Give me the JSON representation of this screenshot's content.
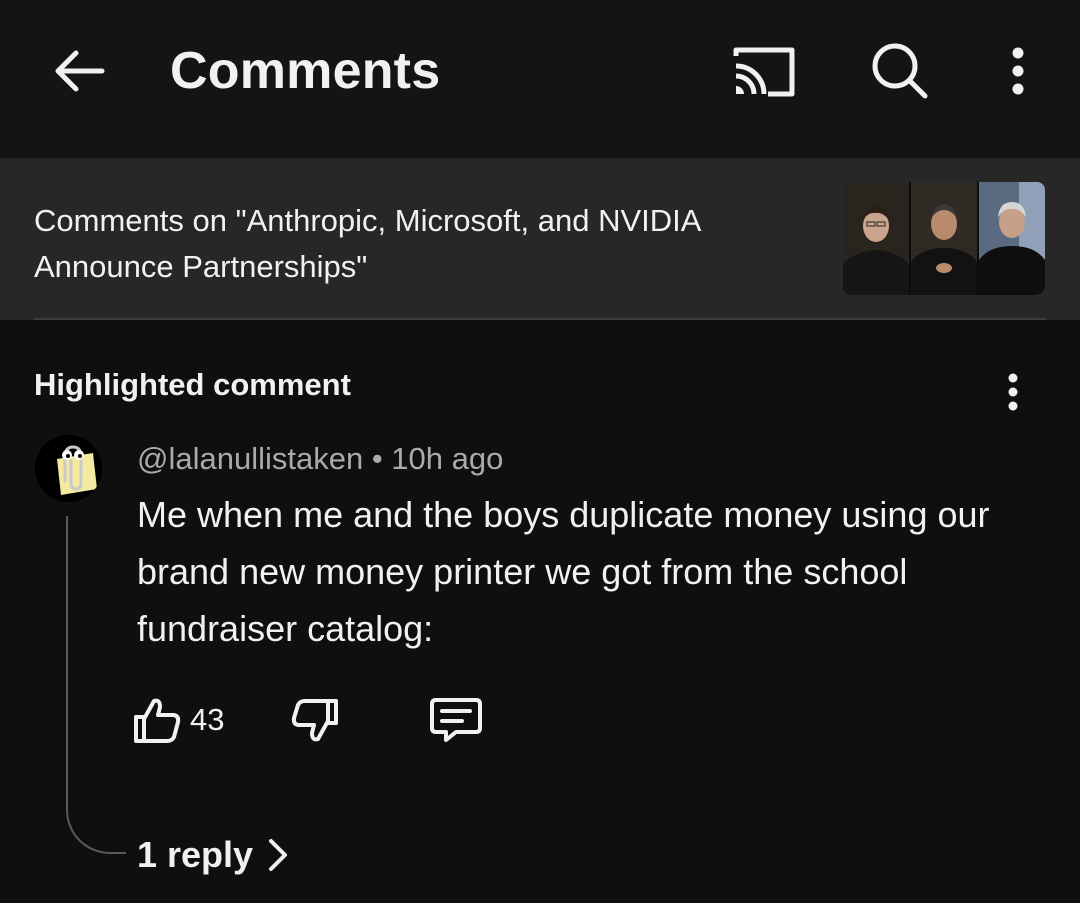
{
  "header": {
    "title": "Comments",
    "icons": {
      "back": "arrow-left-icon",
      "cast": "cast-icon",
      "search": "search-icon",
      "more": "more-vertical-icon"
    }
  },
  "video": {
    "title": "Comments on \"Anthropic, Microsoft, and NVIDIA Announce Partnerships\""
  },
  "highlighted": {
    "label": "Highlighted comment",
    "comment": {
      "author": "@lalanullistaken",
      "separator": " • ",
      "time": "10h ago",
      "text": "Me when me and the boys duplicate money using our brand new money printer we got from the school fundraiser catalog:",
      "likes": "43",
      "replies_label": "1 reply"
    }
  },
  "colors": {
    "background": "#0f0f0f",
    "appbar": "#141414",
    "banner": "#272727",
    "primary_text": "#f1f1f1",
    "secondary_text": "#aaaaaa"
  }
}
